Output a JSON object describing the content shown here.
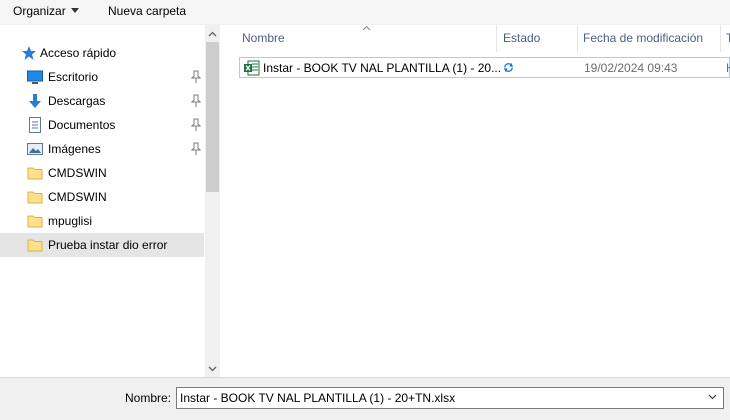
{
  "toolbar": {
    "organize_label": "Organizar",
    "new_folder_label": "Nueva carpeta"
  },
  "nav": {
    "items": [
      {
        "label": "Acceso rápido",
        "icon": "star-icon",
        "pinned": false
      },
      {
        "label": "Escritorio",
        "icon": "desktop-icon",
        "pinned": true
      },
      {
        "label": "Descargas",
        "icon": "download-icon",
        "pinned": true
      },
      {
        "label": "Documentos",
        "icon": "document-icon",
        "pinned": true
      },
      {
        "label": "Imágenes",
        "icon": "pictures-icon",
        "pinned": true
      },
      {
        "label": "CMDSWIN",
        "icon": "folder-icon",
        "pinned": false
      },
      {
        "label": "CMDSWIN",
        "icon": "folder-icon",
        "pinned": false
      },
      {
        "label": "mpuglisi",
        "icon": "folder-icon",
        "pinned": false
      },
      {
        "label": "Prueba instar dio error",
        "icon": "folder-icon",
        "pinned": false,
        "selected": true
      }
    ]
  },
  "list": {
    "columns": [
      "Nombre",
      "Estado",
      "Fecha de modificación",
      "T"
    ],
    "rows": [
      {
        "name": "Instar - BOOK TV NAL PLANTILLA (1) - 20...",
        "status_icon": "sync-icon",
        "modified": "19/02/2024 09:43",
        "type": "H",
        "icon": "excel-icon"
      }
    ]
  },
  "bottom": {
    "filename_label": "Nombre:",
    "filename_value": "Instar - BOOK TV NAL PLANTILLA (1) - 20+TN.xlsx"
  },
  "colors": {
    "selection_border": "#99d1ff",
    "selected_nav": "#e5e5e5",
    "header_text": "#4d6082"
  }
}
